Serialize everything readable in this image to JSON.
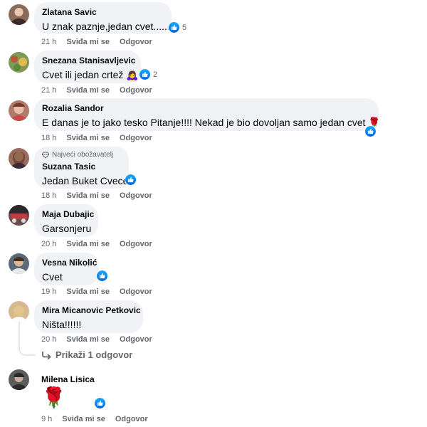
{
  "actions": {
    "like": "Sviđa mi se",
    "reply": "Odgovor"
  },
  "comments": [
    {
      "author": "Zlatana Savic",
      "text": "U znak paznje,jedan cvet......!!",
      "time": "21 h",
      "likes": "5",
      "avatar_color": "#8a6b5a"
    },
    {
      "author": "Snezana Stanisavljevic",
      "text": "Cvet ili jedan crtež",
      "emoji": "🙇‍♀️",
      "time": "21 h",
      "likes": "2",
      "avatar_color": "#7d9a5b"
    },
    {
      "author": "Rozalia Sandor",
      "text": "E danas je to jako tesko Pitanje!!!! Nekad je bio dovoljan samo jedan cvet",
      "emoji": "🌹",
      "time": "18 h",
      "avatar_color": "#b07a6a"
    },
    {
      "fan_badge": "Najveći obožavatelj",
      "author": "Suzana Tasic",
      "text": "Jedan Buket Cvece",
      "time": "18 h",
      "avatar_color": "#9a6a5c"
    },
    {
      "author": "Maja Dubajic",
      "text": "Garsonjeru",
      "time": "20 h",
      "avatar_color": "#6a4a4a"
    },
    {
      "author": "Vesna Nikolić",
      "text": "Cvet",
      "time": "19 h",
      "avatar_color": "#5a6a7a"
    },
    {
      "author": "Mira Micanovic Petkovic",
      "text": "Ništa!!!!!!",
      "time": "20 h",
      "avatar_color": "#d8b890"
    },
    {
      "author": "Milena Lisica",
      "emoji": "🌹",
      "time": "9 h",
      "avatar_color": "#5c5c5c"
    }
  ],
  "show_replies": "Prikaži 1 odgovor",
  "colors": {
    "bubble": "#f0f2f5",
    "meta": "#65676b",
    "like_blue": "#0866ff"
  }
}
